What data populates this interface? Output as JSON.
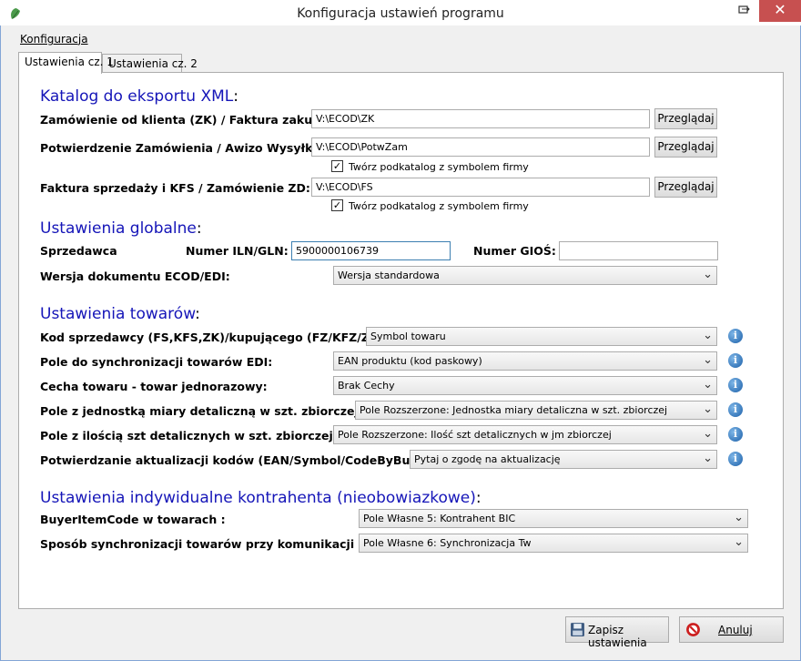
{
  "window": {
    "title": "Konfiguracja ustawień programu"
  },
  "menu": {
    "konfiguracja": "Konfiguracja"
  },
  "tabs": [
    {
      "label": "Ustawienia cz. 1"
    },
    {
      "label": "Ustawienia cz. 2"
    }
  ],
  "export": {
    "section_title": "Katalog do eksportu XML",
    "colon": ":",
    "zk_label": "Zamówienie od klienta (ZK) / Faktura zakupu:",
    "zk_value": "V:\\ECOD\\ZK",
    "potw_label": "Potwierdzenie Zamówienia / Awizo Wysyłki:",
    "potw_value": "V:\\ECOD\\PotwZam",
    "fs_label": "Faktura sprzedaży i KFS / Zamówienie ZD:",
    "fs_value": "V:\\ECOD\\FS",
    "browse_label": "Przeglądaj",
    "subfolder_label": "Twórz podkatalog z symbolem firmy"
  },
  "global": {
    "section_title": "Ustawienia globalne",
    "colon": ":",
    "seller_label": "Sprzedawca",
    "iln_label": "Numer ILN/GLN:",
    "iln_value": "5900000106739",
    "gios_label": "Numer GIOŚ:",
    "gios_value": "",
    "version_label": "Wersja dokumentu ECOD/EDI:",
    "version_value": "Wersja standardowa"
  },
  "goods": {
    "section_title": "Ustawienia towarów",
    "colon": ":",
    "rows": [
      {
        "label": "Kod sprzedawcy (FS,KFS,ZK)/kupującego (FZ/KFZ/ZD):",
        "value": "Symbol towaru"
      },
      {
        "label": "Pole do synchronizacji towarów EDI:",
        "value": "EAN produktu (kod paskowy)"
      },
      {
        "label": "Cecha towaru - towar jednorazowy:",
        "value": "Brak Cechy"
      },
      {
        "label": "Pole z jednostką miary detaliczną w szt. zbiorczej:",
        "value": "Pole Rozszerzone: Jednostka miary detaliczna w szt. zbiorczej"
      },
      {
        "label": "Pole z ilością szt detalicznych w szt. zbiorczej:",
        "value": "Pole Rozszerzone: Ilość szt detalicznych w jm zbiorczej"
      },
      {
        "label": "Potwierdzanie aktualizacji kodów (EAN/Symbol/CodeByBuyer):",
        "value": "Pytaj o zgodę na aktualizację"
      }
    ]
  },
  "contractor": {
    "section_title": "Ustawienia indywidualne kontrahenta (nieobowiazkowe)",
    "colon": ":",
    "rows": [
      {
        "label": "BuyerItemCode w towarach :",
        "value": "Pole Własne 5: Kontrahent BIC"
      },
      {
        "label": "Sposób synchronizacji towarów przy komunikacji EDI:",
        "value": "Pole Własne 6: Synchronizacja Tw"
      }
    ]
  },
  "footer": {
    "save_label": "Zapisz ustawienia",
    "cancel_label": "Anuluj"
  },
  "icons": {
    "info": "info-icon",
    "save": "floppy-disk-icon",
    "cancel": "no-entry-icon",
    "app": "app-leaf-icon",
    "close": "close-icon",
    "restore": "restore-icon",
    "dropdown": "chevron-down-icon"
  },
  "colors": {
    "section_title": "#1515b8",
    "close_button": "#c75050",
    "info_icon": "#1b5fa8",
    "cancel_icon": "#cc1f1f"
  }
}
